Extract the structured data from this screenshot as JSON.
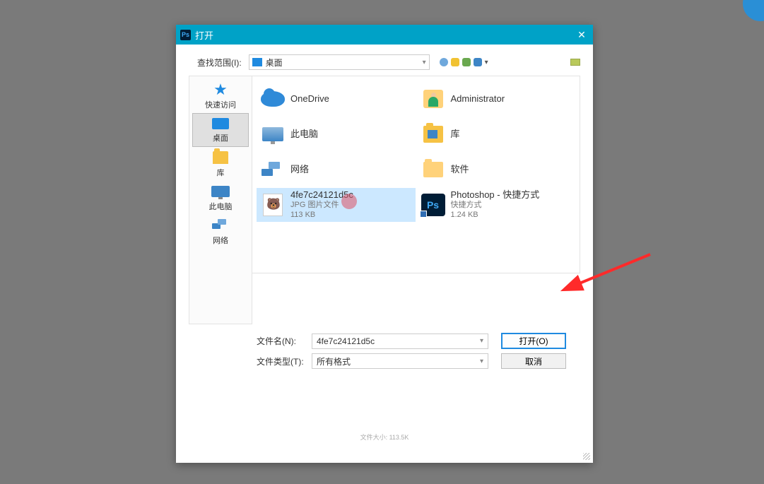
{
  "dialog": {
    "title": "打开",
    "look_in_label": "查找范围(I):",
    "look_in_value": "桌面",
    "places": [
      {
        "label": "快速访问",
        "icon": "star"
      },
      {
        "label": "桌面",
        "icon": "desktop",
        "selected": true
      },
      {
        "label": "库",
        "icon": "library"
      },
      {
        "label": "此电脑",
        "icon": "pc"
      },
      {
        "label": "网络",
        "icon": "network"
      }
    ],
    "files": [
      {
        "name": "OneDrive",
        "icon": "onedrive"
      },
      {
        "name": "Administrator",
        "icon": "admin"
      },
      {
        "name": "此电脑",
        "icon": "mypc"
      },
      {
        "name": "库",
        "icon": "librar"
      },
      {
        "name": "网络",
        "icon": "net2"
      },
      {
        "name": "软件",
        "icon": "folder"
      },
      {
        "name": "4fe7c24121d5c",
        "sub1": "JPG 图片文件",
        "sub2": "113 KB",
        "icon": "jpg",
        "selected": true
      },
      {
        "name": "Photoshop - 快捷方式",
        "sub1": "快捷方式",
        "sub2": "1.24 KB",
        "icon": "ps"
      }
    ],
    "filename_label": "文件名(N):",
    "filename_value": "4fe7c24121d5c",
    "filetype_label": "文件类型(T):",
    "filetype_value": "所有格式",
    "open_button": "打开(O)",
    "cancel_button": "取消",
    "footer_note": "文件大小: 113.5K"
  }
}
